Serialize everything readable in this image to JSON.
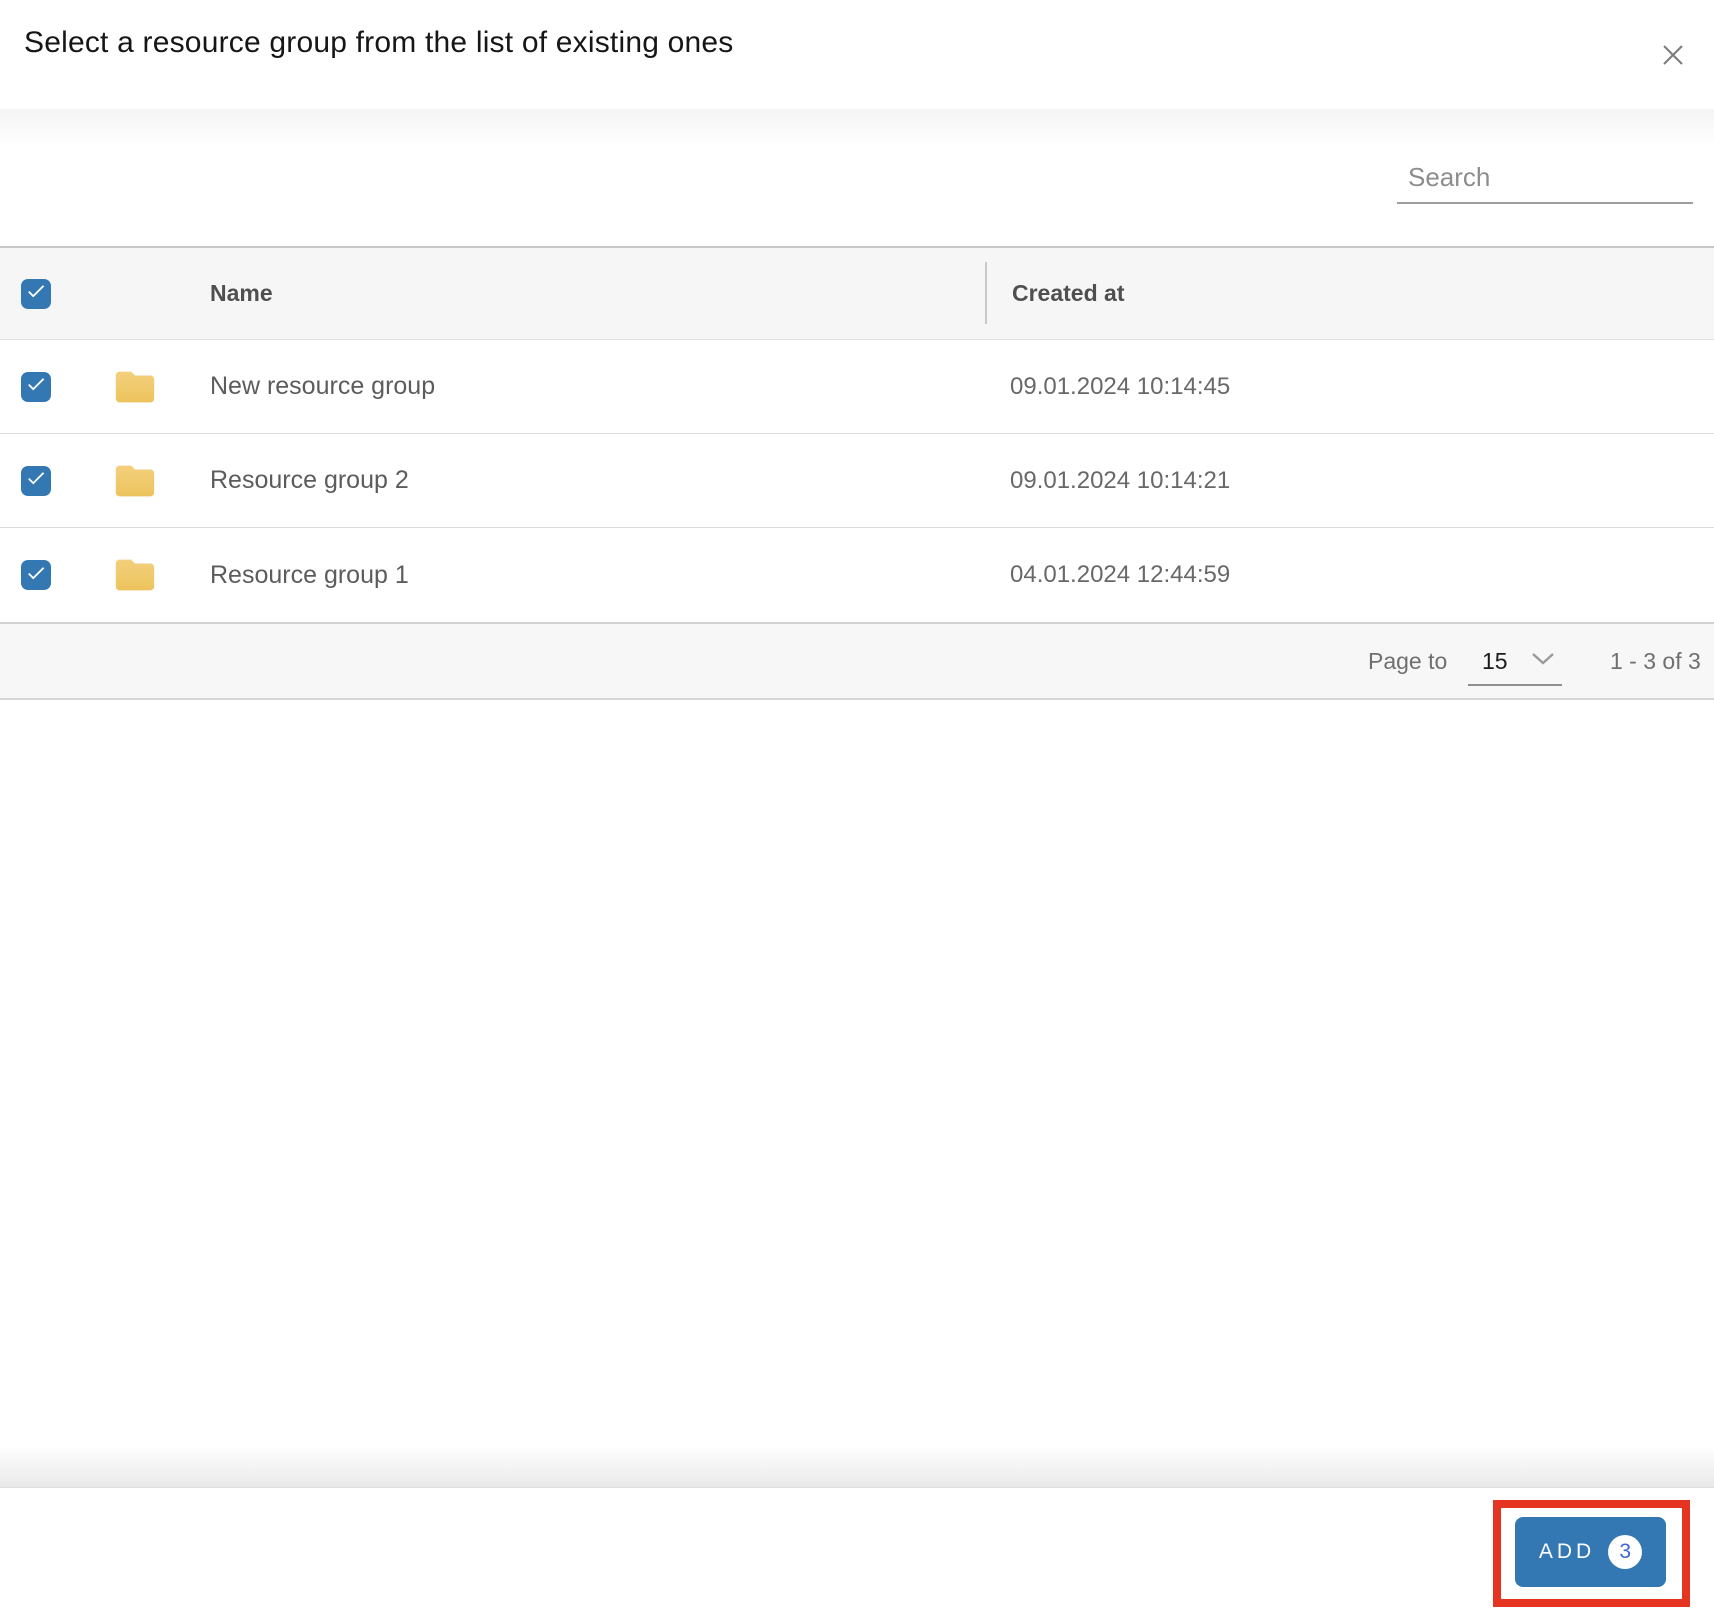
{
  "dialog": {
    "title": "Select a resource group from the list of existing ones"
  },
  "search": {
    "placeholder": "Search"
  },
  "table": {
    "columns": {
      "name": "Name",
      "created_at": "Created at"
    },
    "rows": [
      {
        "name": "New resource group",
        "created_at": "09.01.2024 10:14:45",
        "checked": true
      },
      {
        "name": "Resource group 2",
        "created_at": "09.01.2024 10:14:21",
        "checked": true
      },
      {
        "name": "Resource group 1",
        "created_at": "04.01.2024 12:44:59",
        "checked": true
      }
    ],
    "header_checkbox_checked": true
  },
  "pagination": {
    "page_to_label": "Page to",
    "page_size": "15",
    "range_label": "1 - 3 of 3"
  },
  "actions": {
    "add_label": "ADD",
    "selected_count": "3"
  },
  "icons": {
    "close": "x-icon",
    "checkbox_check": "check-icon",
    "folder": "folder-icon",
    "chevron_down": "chevron-down-icon"
  },
  "colors": {
    "primary_blue": "#3478b3",
    "badge_number_blue": "#3c66d4",
    "highlight_red": "#e53422",
    "folder_yellow_top": "#f4d07d",
    "folder_yellow_bottom": "#ecc35c",
    "header_bar_gray": "#f6f6f6",
    "row_text_gray": "#5c5c5c"
  }
}
